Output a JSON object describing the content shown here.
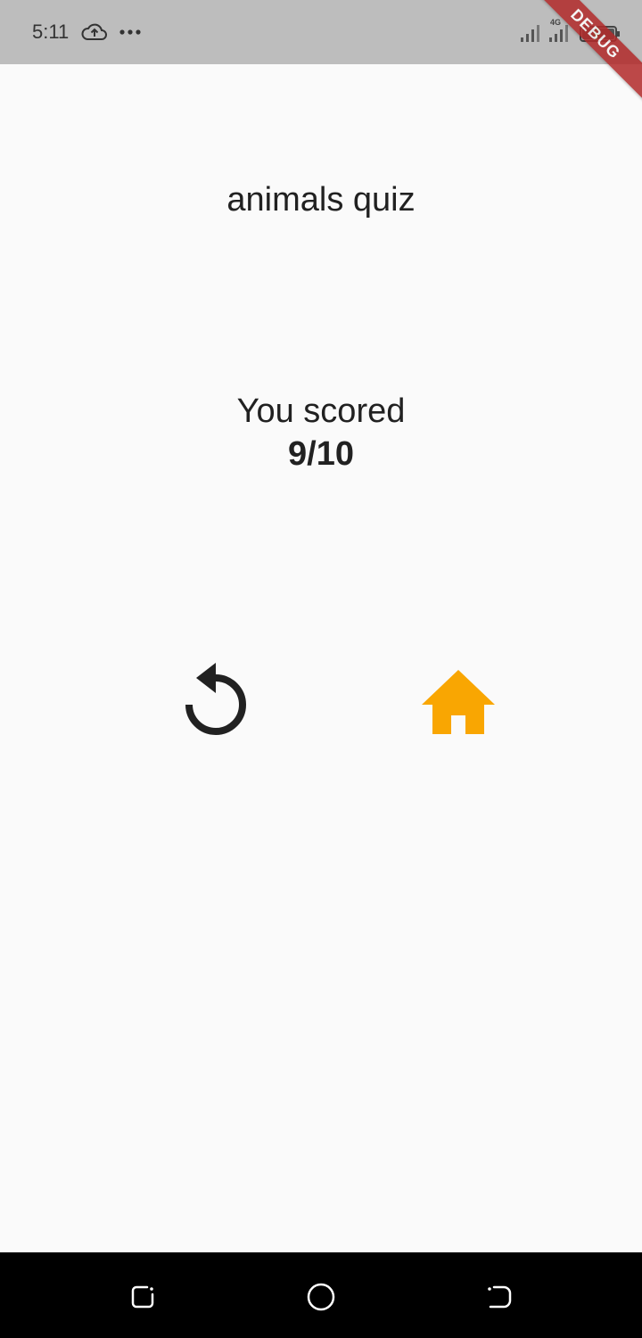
{
  "status_bar": {
    "time": "5:11",
    "network_label": "4G",
    "icons": [
      "cloud-upload-icon",
      "more-dots-icon",
      "signal-icon",
      "signal-icon",
      "battery-icon"
    ]
  },
  "debug_banner": "DEBUG",
  "quiz": {
    "title": "animals quiz",
    "score_label": "You scored",
    "score_value": "9/10"
  },
  "actions": {
    "retry_icon": "replay-icon",
    "home_icon": "home-icon",
    "home_color": "#f9a602"
  },
  "nav_bar": {
    "icons": [
      "recent-apps-icon",
      "home-circle-icon",
      "back-icon"
    ]
  },
  "colors": {
    "status_bar_bg": "#bdbdbd",
    "page_bg": "#fafafa",
    "text": "#212121",
    "debug_ribbon": "#b22a2a"
  }
}
